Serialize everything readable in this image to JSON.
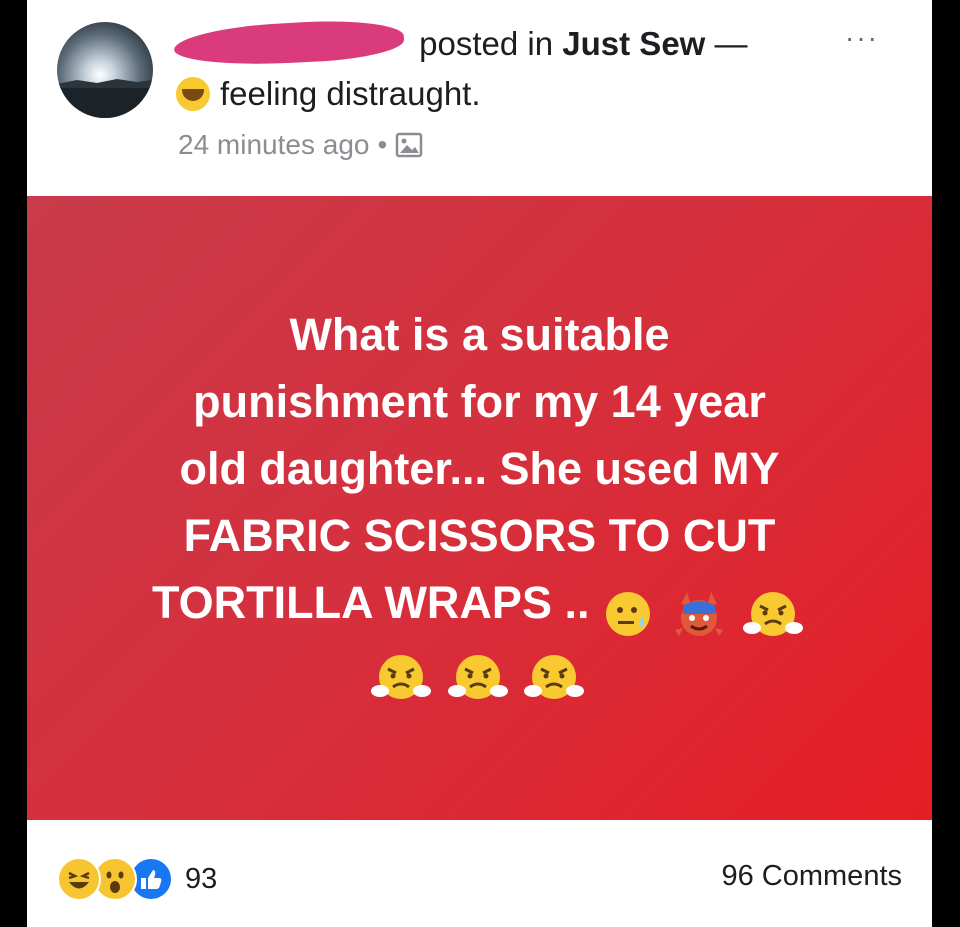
{
  "post": {
    "posted_in_label": "posted in",
    "group_name": "Just Sew",
    "dash": "—",
    "feeling_text": "feeling distraught.",
    "timestamp": "24 minutes ago",
    "meta_dot": "•",
    "audience_icon": "photo-icon",
    "more_label": "···"
  },
  "banner": {
    "text_lines": [
      "What is a suitable",
      "punishment for my 14 year",
      "old daughter... She used MY",
      "FABRIC SCISSORS TO CUT",
      "TORTILLA WRAPS .."
    ],
    "background_colors": [
      "#c93a4a",
      "#e51e25"
    ],
    "emojis_line1": [
      "sweat-face-icon",
      "devil-face-icon",
      "angry-face-icon"
    ],
    "emojis_line2": [
      "angry-face-icon",
      "angry-face-icon",
      "angry-face-icon"
    ]
  },
  "footer": {
    "reaction_icons": [
      "haha-icon",
      "wow-icon",
      "like-icon"
    ],
    "reaction_count": "93",
    "comments_count": "96 Comments"
  }
}
